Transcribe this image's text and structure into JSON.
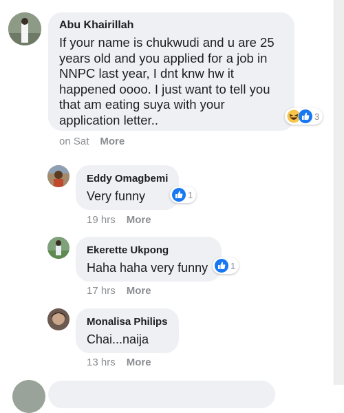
{
  "comments": [
    {
      "author": "Abu Khairillah",
      "text_lines": [
        "If your name is chukwudi and u are 25",
        "years old and you applied for a job in",
        "NNPC last year, I dnt knw hw it",
        "happened oooo. I just want to tell you",
        "that am eating suya with your",
        "application letter.."
      ],
      "reactions": [
        "haha-icon",
        "like-icon"
      ],
      "reaction_count": "3",
      "time": "on Sat",
      "more": "More"
    },
    {
      "author": "Eddy Omagbemi",
      "text": "Very funny",
      "reactions": [
        "like-icon"
      ],
      "reaction_count": "1",
      "time": "19 hrs",
      "more": "More"
    },
    {
      "author": "Ekerette Ukpong",
      "text": "Haha haha very funny",
      "reactions": [
        "like-icon"
      ],
      "reaction_count": "1",
      "time": "17 hrs",
      "more": "More"
    },
    {
      "author": "Monalisa Philips",
      "text": "Chai...naija",
      "time": "13 hrs",
      "more": "More"
    }
  ],
  "colors": {
    "bubble": "#eef0f3",
    "like": "#1877f2",
    "meta": "#8a8d91",
    "text": "#1c1e21"
  }
}
